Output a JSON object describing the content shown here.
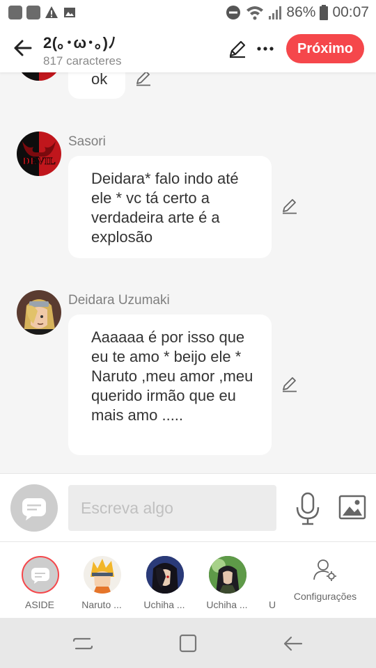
{
  "status_bar": {
    "battery": "86%",
    "time": "00:07"
  },
  "header": {
    "title": "2(｡･ω･｡)ﾉ",
    "subtitle": "817 caracteres",
    "next_label": "Próximo"
  },
  "messages": [
    {
      "sender": "",
      "text": "ok"
    },
    {
      "sender": "Sasori",
      "text": "Deidara* falo indo até ele * vc tá certo a verdadeira arte é a explosão",
      "avatar": "devil-avatar"
    },
    {
      "sender": "Deidara Uzumaki",
      "text": "Aaaaaa é por isso que eu te amo * beijo ele * Naruto ,meu amor ,meu querido irmão que eu mais amo .....",
      "avatar": "deidara-avatar"
    }
  ],
  "composer": {
    "placeholder": "Escreva algo"
  },
  "tabs": [
    {
      "label": "ASIDE"
    },
    {
      "label": "Naruto ..."
    },
    {
      "label": "Uchiha ..."
    },
    {
      "label": "Uchiha ..."
    },
    {
      "label": "U"
    },
    {
      "label": "Configurações"
    }
  ],
  "colors": {
    "accent": "#f5474b",
    "bubble": "#ffffff",
    "background": "#f5f5f5"
  }
}
